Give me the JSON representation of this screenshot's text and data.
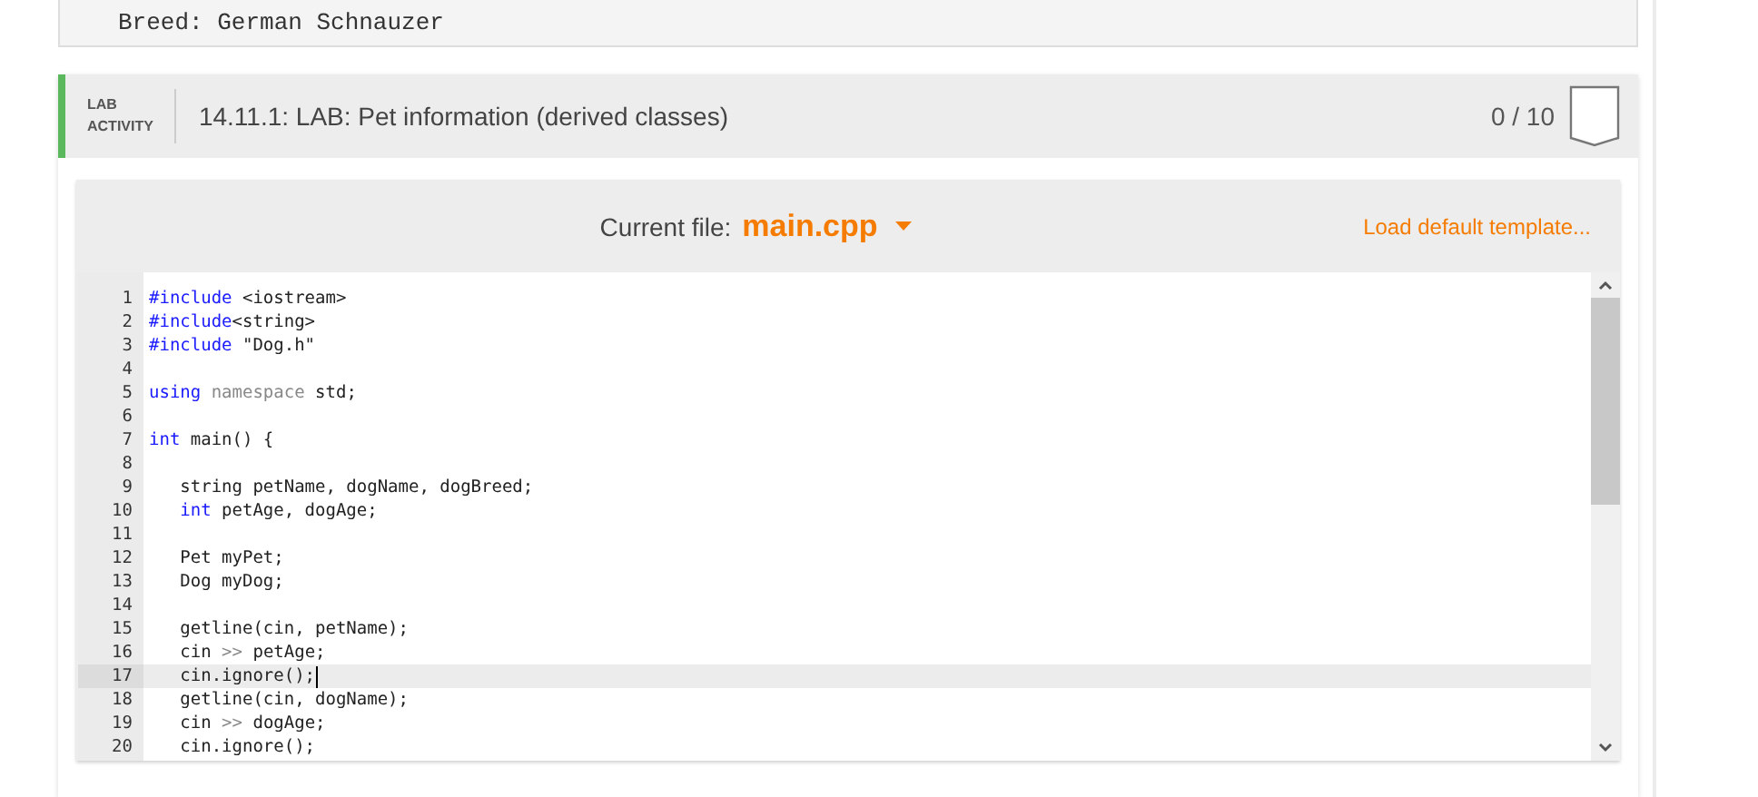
{
  "previous_output": {
    "text": "Breed: German Schnauzer"
  },
  "lab": {
    "label_top": "LAB",
    "label_bottom": "ACTIVITY",
    "title": "14.11.1: LAB: Pet information (derived classes)",
    "score": "0 / 10",
    "editor": {
      "file_label": "Current file:",
      "file_name": "main.cpp",
      "template_link": "Load default template...",
      "lines": [
        {
          "number": "1",
          "active": false,
          "tokens": [
            {
              "kind": "keyword",
              "text": "#include"
            },
            {
              "kind": "plain",
              "text": " <iostream>"
            }
          ]
        },
        {
          "number": "2",
          "active": false,
          "tokens": [
            {
              "kind": "keyword",
              "text": "#include"
            },
            {
              "kind": "plain",
              "text": "<string>"
            }
          ]
        },
        {
          "number": "3",
          "active": false,
          "tokens": [
            {
              "kind": "keyword",
              "text": "#include"
            },
            {
              "kind": "plain",
              "text": " \"Dog.h\""
            }
          ]
        },
        {
          "number": "4",
          "active": false
        },
        {
          "number": "5",
          "active": false,
          "tokens": [
            {
              "kind": "keyword",
              "text": "using"
            },
            {
              "kind": "muted",
              "text": " namespace"
            },
            {
              "kind": "plain",
              "text": " std;"
            }
          ]
        },
        {
          "number": "6",
          "active": false
        },
        {
          "number": "7",
          "active": false,
          "tokens": [
            {
              "kind": "keyword",
              "text": "int"
            },
            {
              "kind": "plain",
              "text": " main() {"
            }
          ]
        },
        {
          "number": "8",
          "active": false
        },
        {
          "number": "9",
          "active": false,
          "tokens": [
            {
              "kind": "plain",
              "text": "   string petName, dogName, dogBreed;"
            }
          ]
        },
        {
          "number": "10",
          "active": false,
          "tokens": [
            {
              "kind": "keyword",
              "text": "   int"
            },
            {
              "kind": "plain",
              "text": " petAge, dogAge;"
            }
          ]
        },
        {
          "number": "11",
          "active": false
        },
        {
          "number": "12",
          "active": false,
          "tokens": [
            {
              "kind": "plain",
              "text": "   Pet myPet;"
            }
          ]
        },
        {
          "number": "13",
          "active": false,
          "tokens": [
            {
              "kind": "plain",
              "text": "   Dog myDog;"
            }
          ]
        },
        {
          "number": "14",
          "active": false
        },
        {
          "number": "15",
          "active": false,
          "tokens": [
            {
              "kind": "plain",
              "text": "   getline(cin, petName);"
            }
          ]
        },
        {
          "number": "16",
          "active": false,
          "tokens": [
            {
              "kind": "plain",
              "text": "   cin "
            },
            {
              "kind": "muted",
              "text": ">>"
            },
            {
              "kind": "plain",
              "text": " petAge;"
            }
          ]
        },
        {
          "number": "17",
          "active": true,
          "tokens": [
            {
              "kind": "plain",
              "text": "   cin.ignore();"
            }
          ]
        },
        {
          "number": "18",
          "active": false,
          "tokens": [
            {
              "kind": "plain",
              "text": "   getline(cin, dogName);"
            }
          ]
        },
        {
          "number": "19",
          "active": false,
          "tokens": [
            {
              "kind": "plain",
              "text": "   cin "
            },
            {
              "kind": "muted",
              "text": ">>"
            },
            {
              "kind": "plain",
              "text": " dogAge;"
            }
          ]
        },
        {
          "number": "20",
          "active": false,
          "tokens": [
            {
              "kind": "plain",
              "text": "   cin.ignore();"
            }
          ]
        }
      ]
    }
  }
}
